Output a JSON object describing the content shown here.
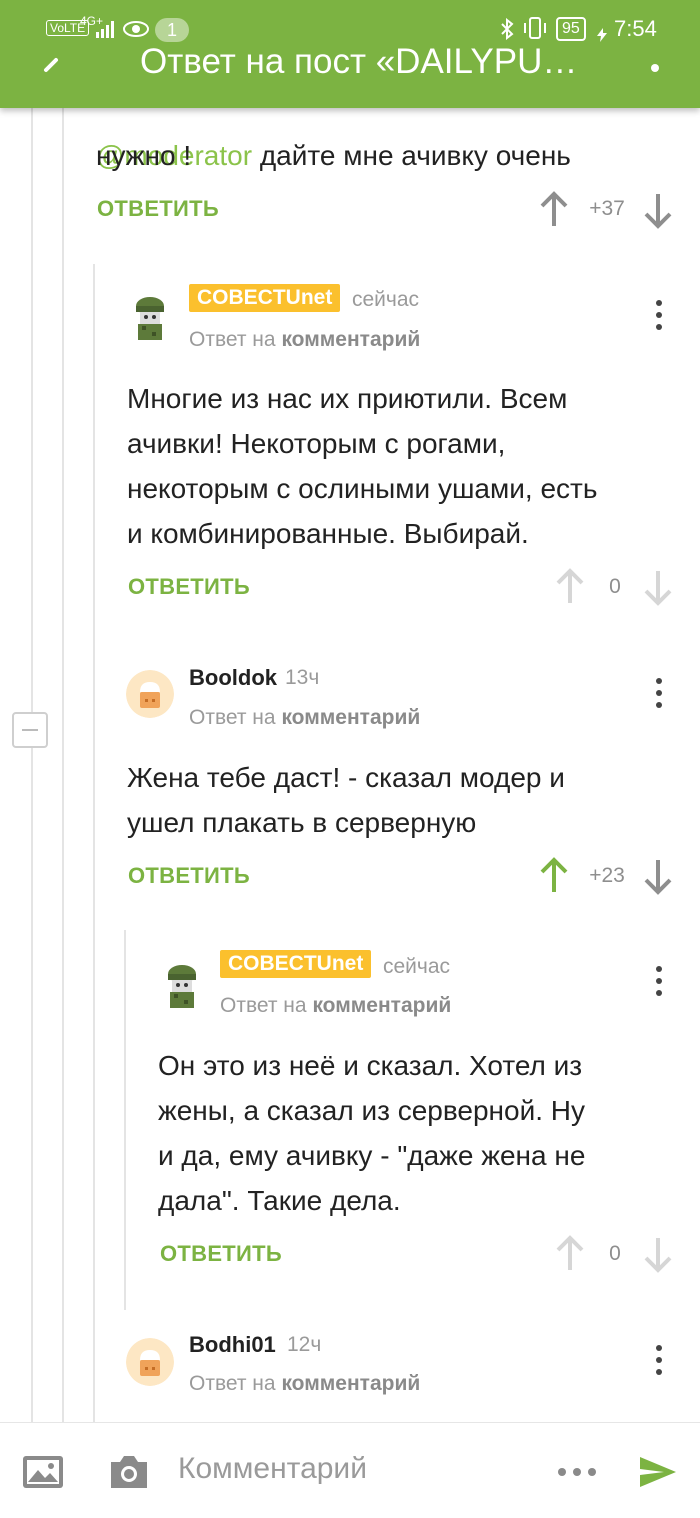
{
  "status_bar": {
    "network": "VoLTE",
    "signal": "4G+",
    "notification_count": "1",
    "battery": "95",
    "time": "7:54"
  },
  "header": {
    "title": "Ответ на пост «DAILYPU…",
    "background": "#7cb342"
  },
  "top_comment": {
    "text_line1": "@moderator дайте мне ачивку очень",
    "mention": "@moderator",
    "text_line2": "нужно !",
    "reply_label": "ОТВЕТИТЬ",
    "score": "+37"
  },
  "comments": [
    {
      "badge": "COBECTUnet",
      "time": "сейчас",
      "reply_to_prefix": "Ответ на",
      "reply_to_link": "комментарий",
      "text": "Многие из нас их приютили. Всем\nачивки! Некоторым с рогами,\nнекоторым с ослиными ушами, есть\nи комбинированные. Выбирай.",
      "reply_label": "ОТВЕТИТЬ",
      "score": "0"
    },
    {
      "username": "Booldok",
      "time": "13ч",
      "reply_to_prefix": "Ответ на",
      "reply_to_link": "комментарий",
      "text": "Жена тебе даст! - сказал модер и\nушел плакать в серверную",
      "reply_label": "ОТВЕТИТЬ",
      "score": "+23"
    },
    {
      "badge": "COBECTUnet",
      "time": "сейчас",
      "reply_to_prefix": "Ответ на",
      "reply_to_link": "комментарий",
      "text": "Он это из неё и сказал. Хотел из\nжены, а сказал из серверной. Ну\nи да, ему ачивку - \"даже жена не\nдала\". Такие дела.",
      "reply_label": "ОТВЕТИТЬ",
      "score": "0"
    },
    {
      "username": "Bodhi01",
      "time": "12ч",
      "reply_to_prefix": "Ответ на",
      "reply_to_link": "комментарий"
    }
  ],
  "bottom_bar": {
    "placeholder": "Комментарий"
  },
  "colors": {
    "accent": "#7cb342",
    "badge": "#fbc02d",
    "mention": "#8bc34a"
  }
}
